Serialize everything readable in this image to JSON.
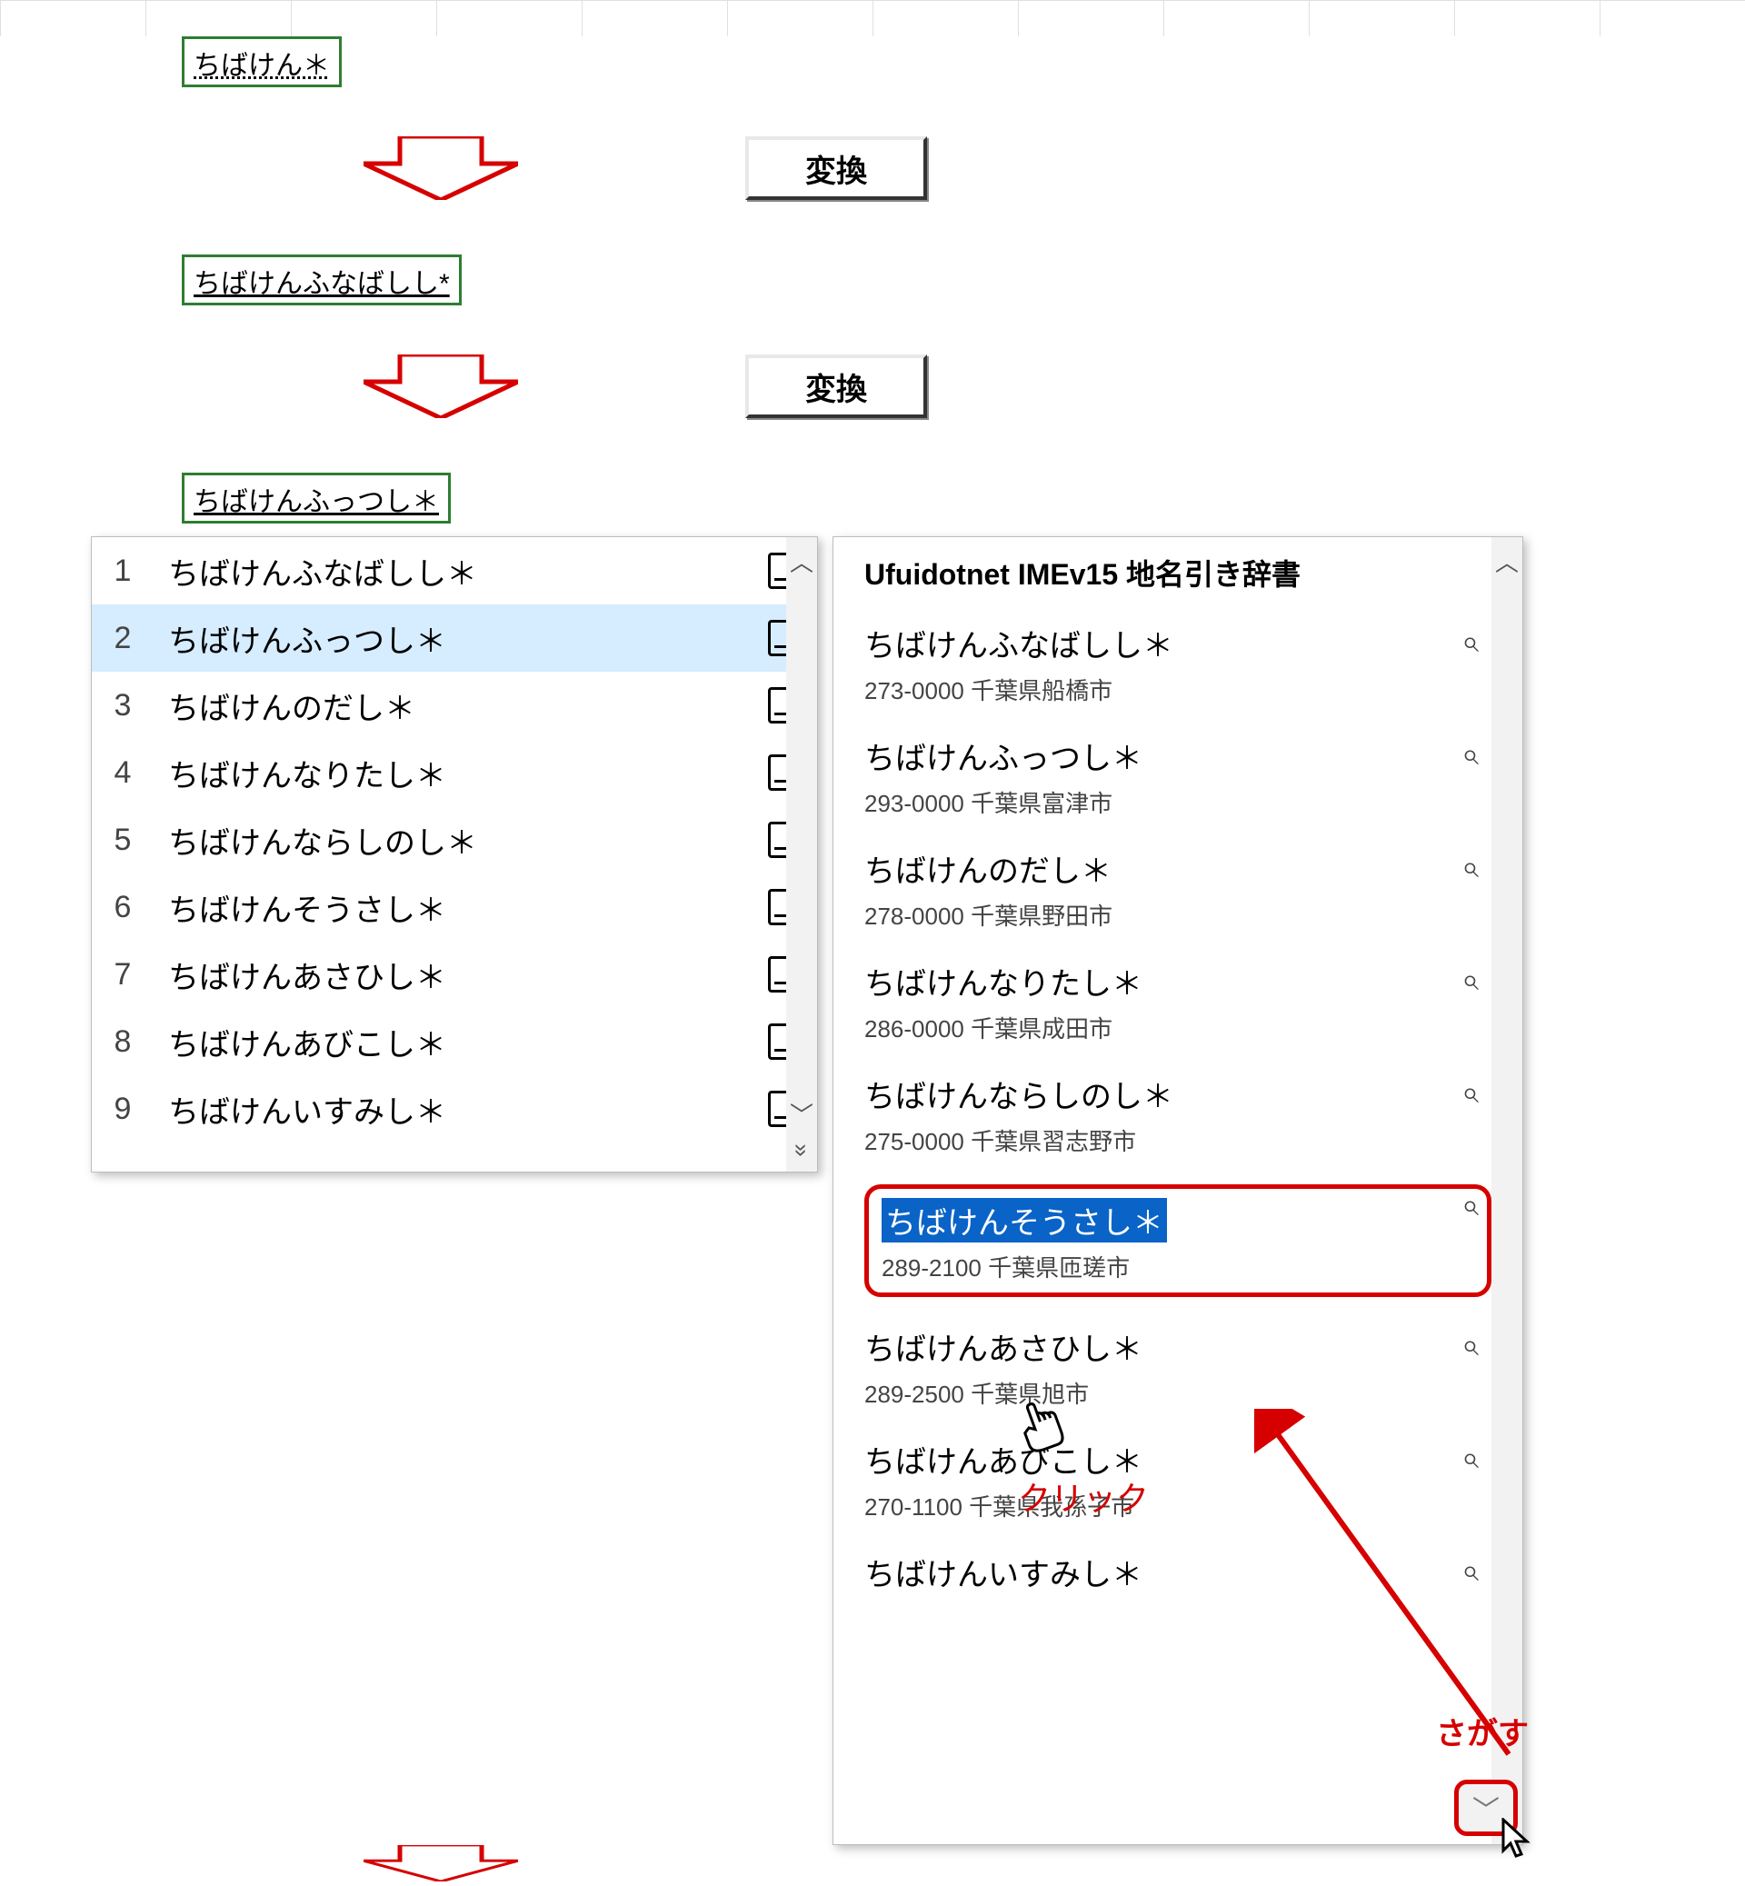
{
  "cells": {
    "c1": "ちばけん＊",
    "c2": "ちばけんふなばしし*",
    "c3": "ちばけんふっつし＊"
  },
  "buttons": {
    "henkan": "変換"
  },
  "candidates": [
    {
      "n": "1",
      "t": "ちばけんふなばしし＊"
    },
    {
      "n": "2",
      "t": "ちばけんふっつし＊"
    },
    {
      "n": "3",
      "t": "ちばけんのだし＊"
    },
    {
      "n": "4",
      "t": "ちばけんなりたし＊"
    },
    {
      "n": "5",
      "t": "ちばけんならしのし＊"
    },
    {
      "n": "6",
      "t": "ちばけんそうさし＊"
    },
    {
      "n": "7",
      "t": "ちばけんあさひし＊"
    },
    {
      "n": "8",
      "t": "ちばけんあびこし＊"
    },
    {
      "n": "9",
      "t": "ちばけんいすみし＊"
    }
  ],
  "candidates_selected_index": 1,
  "dict": {
    "title": "Ufuidotnet IMEv15 地名引き辞書",
    "items": [
      {
        "l1": "ちばけんふなばしし＊",
        "l2": "273-0000 千葉県船橋市",
        "hi": false
      },
      {
        "l1": "ちばけんふっつし＊",
        "l2": "293-0000 千葉県富津市",
        "hi": false
      },
      {
        "l1": "ちばけんのだし＊",
        "l2": "278-0000 千葉県野田市",
        "hi": false
      },
      {
        "l1": "ちばけんなりたし＊",
        "l2": "286-0000 千葉県成田市",
        "hi": false
      },
      {
        "l1": "ちばけんならしのし＊",
        "l2": "275-0000 千葉県習志野市",
        "hi": false
      },
      {
        "l1": "ちばけんそうさし＊",
        "l2": "289-2100 千葉県匝瑳市",
        "hi": true
      },
      {
        "l1": "ちばけんあさひし＊",
        "l2": "289-2500 千葉県旭市",
        "hi": false
      },
      {
        "l1": "ちばけんあびこし＊",
        "l2": "270-1100 千葉県我孫子市",
        "hi": false
      },
      {
        "l1": "ちばけんいすみし＊",
        "l2": "",
        "hi": false,
        "partial": true
      }
    ]
  },
  "annot": {
    "click": "クリック",
    "sagasu": "さがす"
  },
  "glyph": {
    "up": "︿",
    "down": "﹀",
    "more": "»",
    "mag": "⌕",
    "cursor_hand": "☝",
    "cursor_arrow": "➤"
  }
}
